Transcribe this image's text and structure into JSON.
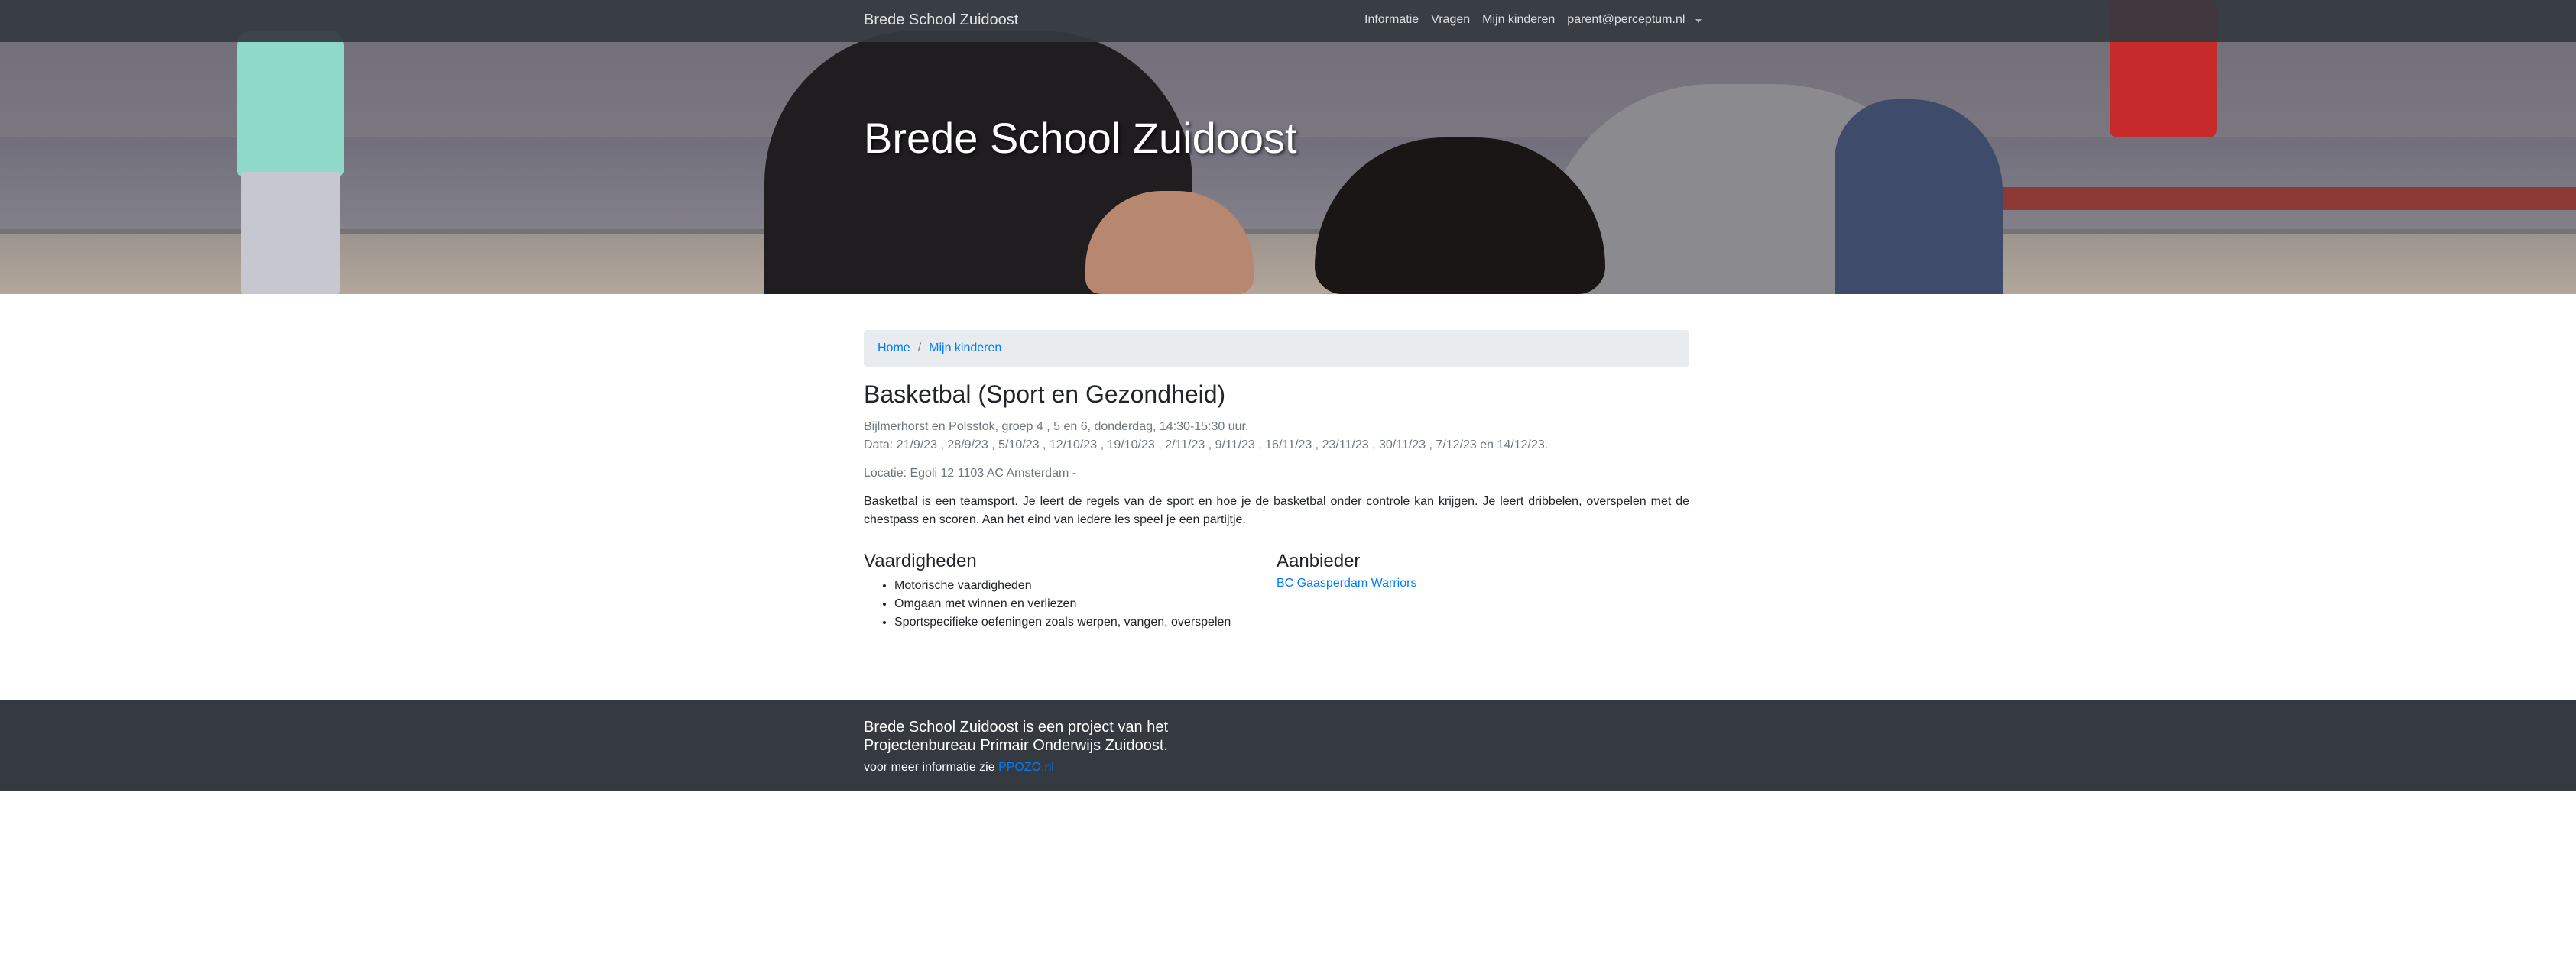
{
  "navbar": {
    "brand": "Brede School Zuidoost",
    "links": [
      "Informatie",
      "Vragen",
      "Mijn kinderen",
      "parent@perceptum.nl"
    ]
  },
  "hero": {
    "title": "Brede School Zuidoost"
  },
  "breadcrumb": {
    "home": "Home",
    "separator": "/",
    "current": "Mijn kinderen"
  },
  "activity": {
    "title": "Basketbal (Sport en Gezondheid)",
    "schedule": "Bijlmerhorst en Polsstok, groep 4 , 5 en 6, donderdag, 14:30-15:30 uur.",
    "dates": "Data: 21/9/23 , 28/9/23 , 5/10/23 , 12/10/23 , 19/10/23 , 2/11/23 , 9/11/23 , 16/11/23 , 23/11/23 , 30/11/23 , 7/12/23 en 14/12/23.",
    "location": "Locatie: Egoli 12 1103 AC Amsterdam -",
    "description": "Basketbal is een teamsport. Je leert de regels van de sport en hoe je de basketbal onder controle kan krijgen. Je leert dribbelen, overspelen met de chestpass en scoren. Aan het eind van iedere les speel je een partijtje."
  },
  "skills": {
    "heading": "Vaardigheden",
    "items": [
      "Motorische vaardigheden",
      "Omgaan met winnen en verliezen",
      "Sportspecifieke oefeningen zoals werpen, vangen, overspelen"
    ]
  },
  "provider": {
    "heading": "Aanbieder",
    "name": "BC Gaasperdam Warriors"
  },
  "footer": {
    "title": "Brede School Zuidoost is een project van het Projectenbureau Primair Onderwijs Zuidoost.",
    "more_prefix": "voor meer informatie zie ",
    "more_link": "PPOZO.nl"
  },
  "colors": {
    "navbar": "#343a40",
    "link": "#007bff",
    "breadcrumb_bg": "#e9ecef",
    "muted": "#6c757d"
  },
  "icons": {
    "user_menu": "caret-down-icon"
  }
}
